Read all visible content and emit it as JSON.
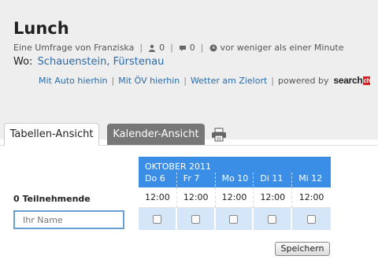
{
  "poll": {
    "title": "Lunch",
    "author_line": "Eine Umfrage von Franziska",
    "participants_count": "0",
    "comments_count": "0",
    "time_ago": "vor weniger als einer Minute"
  },
  "location": {
    "label": "Wo:",
    "value": "Schauenstein, Fürstenau"
  },
  "links": {
    "car": "Mit Auto hierhin",
    "public_transport": "Mit ÖV hierhin",
    "weather": "Wetter am Zielort",
    "powered_by": "powered by",
    "logo_text": "search",
    "logo_suffix": "ch"
  },
  "tabs": {
    "table": "Tabellen-Ansicht",
    "calendar": "Kalender-Ansicht"
  },
  "grid": {
    "month": "OKTOBER 2011",
    "days": [
      "Do 6",
      "Fr 7",
      "Mo 10",
      "Di 11",
      "Mi 12"
    ],
    "times": [
      "12:00",
      "12:00",
      "12:00",
      "12:00",
      "12:00"
    ]
  },
  "form": {
    "participants_label": "0 Teilnehmende",
    "name_placeholder": "Ihr Name",
    "save_label": "Speichern"
  },
  "colors": {
    "header_blue": "#3a8ee6",
    "check_cell": "#d5e6f8",
    "link": "#2a6aa8",
    "active_tab": "#ffffff",
    "inactive_tab": "#777777"
  },
  "icons": [
    "user-icon",
    "comment-icon",
    "clock-icon",
    "printer-icon"
  ]
}
